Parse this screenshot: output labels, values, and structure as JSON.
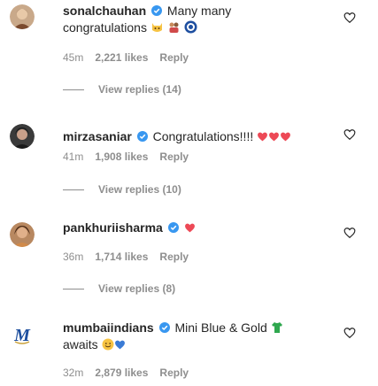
{
  "comments": [
    {
      "username": "sonalchauhan",
      "text_line1": "Many many",
      "text_line2": "congratulations",
      "time": "45m",
      "likes": "2,221 likes",
      "reply": "Reply",
      "view_replies": "View replies (14)"
    },
    {
      "username": "mirzasaniar",
      "text_line1": "Congratulations!!!!",
      "time": "41m",
      "likes": "1,908 likes",
      "reply": "Reply",
      "view_replies": "View replies (10)"
    },
    {
      "username": "pankhuriisharma",
      "time": "36m",
      "likes": "1,714 likes",
      "reply": "Reply",
      "view_replies": "View replies (8)"
    },
    {
      "username": "mumbaiindians",
      "text_line1": "Mini Blue & Gold",
      "text_line2": "awaits",
      "time": "32m",
      "likes": "2,879 likes",
      "reply": "Reply"
    }
  ],
  "colors": {
    "verified": "#3897f0",
    "heart_red": "#ed4956",
    "meta_gray": "#8e8e8e",
    "text": "#262626"
  },
  "icons": {
    "like_button": "heart-outline-icon",
    "verified_badge": "verified-badge-icon"
  }
}
